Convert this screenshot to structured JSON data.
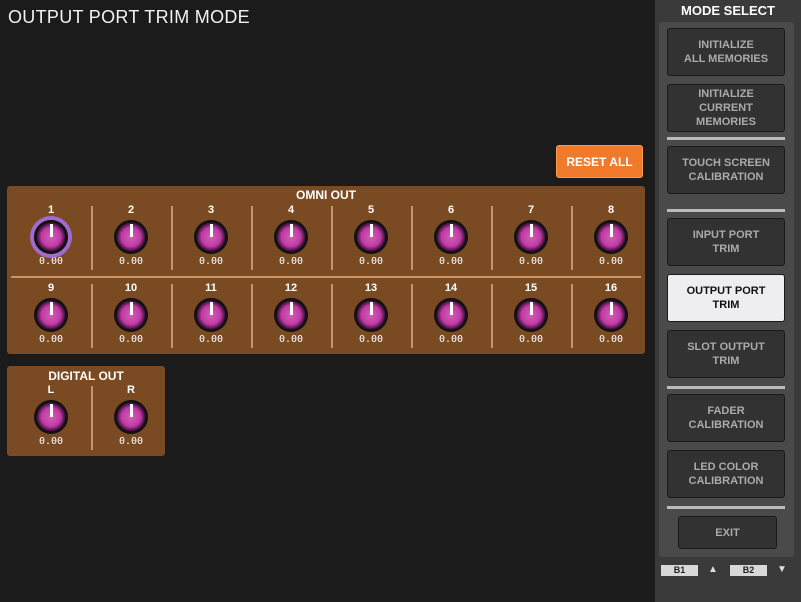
{
  "title": "OUTPUT PORT TRIM MODE",
  "reset_label": "RESET ALL",
  "omni": {
    "title": "OMNI OUT",
    "channels": [
      {
        "label": "1",
        "value": "0.00"
      },
      {
        "label": "2",
        "value": "0.00"
      },
      {
        "label": "3",
        "value": "0.00"
      },
      {
        "label": "4",
        "value": "0.00"
      },
      {
        "label": "5",
        "value": "0.00"
      },
      {
        "label": "6",
        "value": "0.00"
      },
      {
        "label": "7",
        "value": "0.00"
      },
      {
        "label": "8",
        "value": "0.00"
      },
      {
        "label": "9",
        "value": "0.00"
      },
      {
        "label": "10",
        "value": "0.00"
      },
      {
        "label": "11",
        "value": "0.00"
      },
      {
        "label": "12",
        "value": "0.00"
      },
      {
        "label": "13",
        "value": "0.00"
      },
      {
        "label": "14",
        "value": "0.00"
      },
      {
        "label": "15",
        "value": "0.00"
      },
      {
        "label": "16",
        "value": "0.00"
      }
    ]
  },
  "digital": {
    "title": "DIGITAL OUT",
    "channels": [
      {
        "label": "L",
        "value": "0.00"
      },
      {
        "label": "R",
        "value": "0.00"
      }
    ]
  },
  "mode_select": {
    "title": "MODE SELECT",
    "buttons": [
      {
        "label": "INITIALIZE\nALL MEMORIES"
      },
      {
        "label": "INITIALIZE\nCURRENT MEMORIES"
      },
      {
        "label": "TOUCH SCREEN\nCALIBRATION"
      },
      {
        "label": "INPUT PORT\nTRIM"
      },
      {
        "label": "OUTPUT PORT\nTRIM",
        "active": true
      },
      {
        "label": "SLOT OUTPUT\nTRIM"
      },
      {
        "label": "FADER\nCALIBRATION"
      },
      {
        "label": "LED COLOR\nCALIBRATION"
      }
    ],
    "exit_label": "EXIT"
  },
  "banks": {
    "b1": "B1",
    "b2": "B2",
    "up": "▲",
    "down": "▼"
  }
}
